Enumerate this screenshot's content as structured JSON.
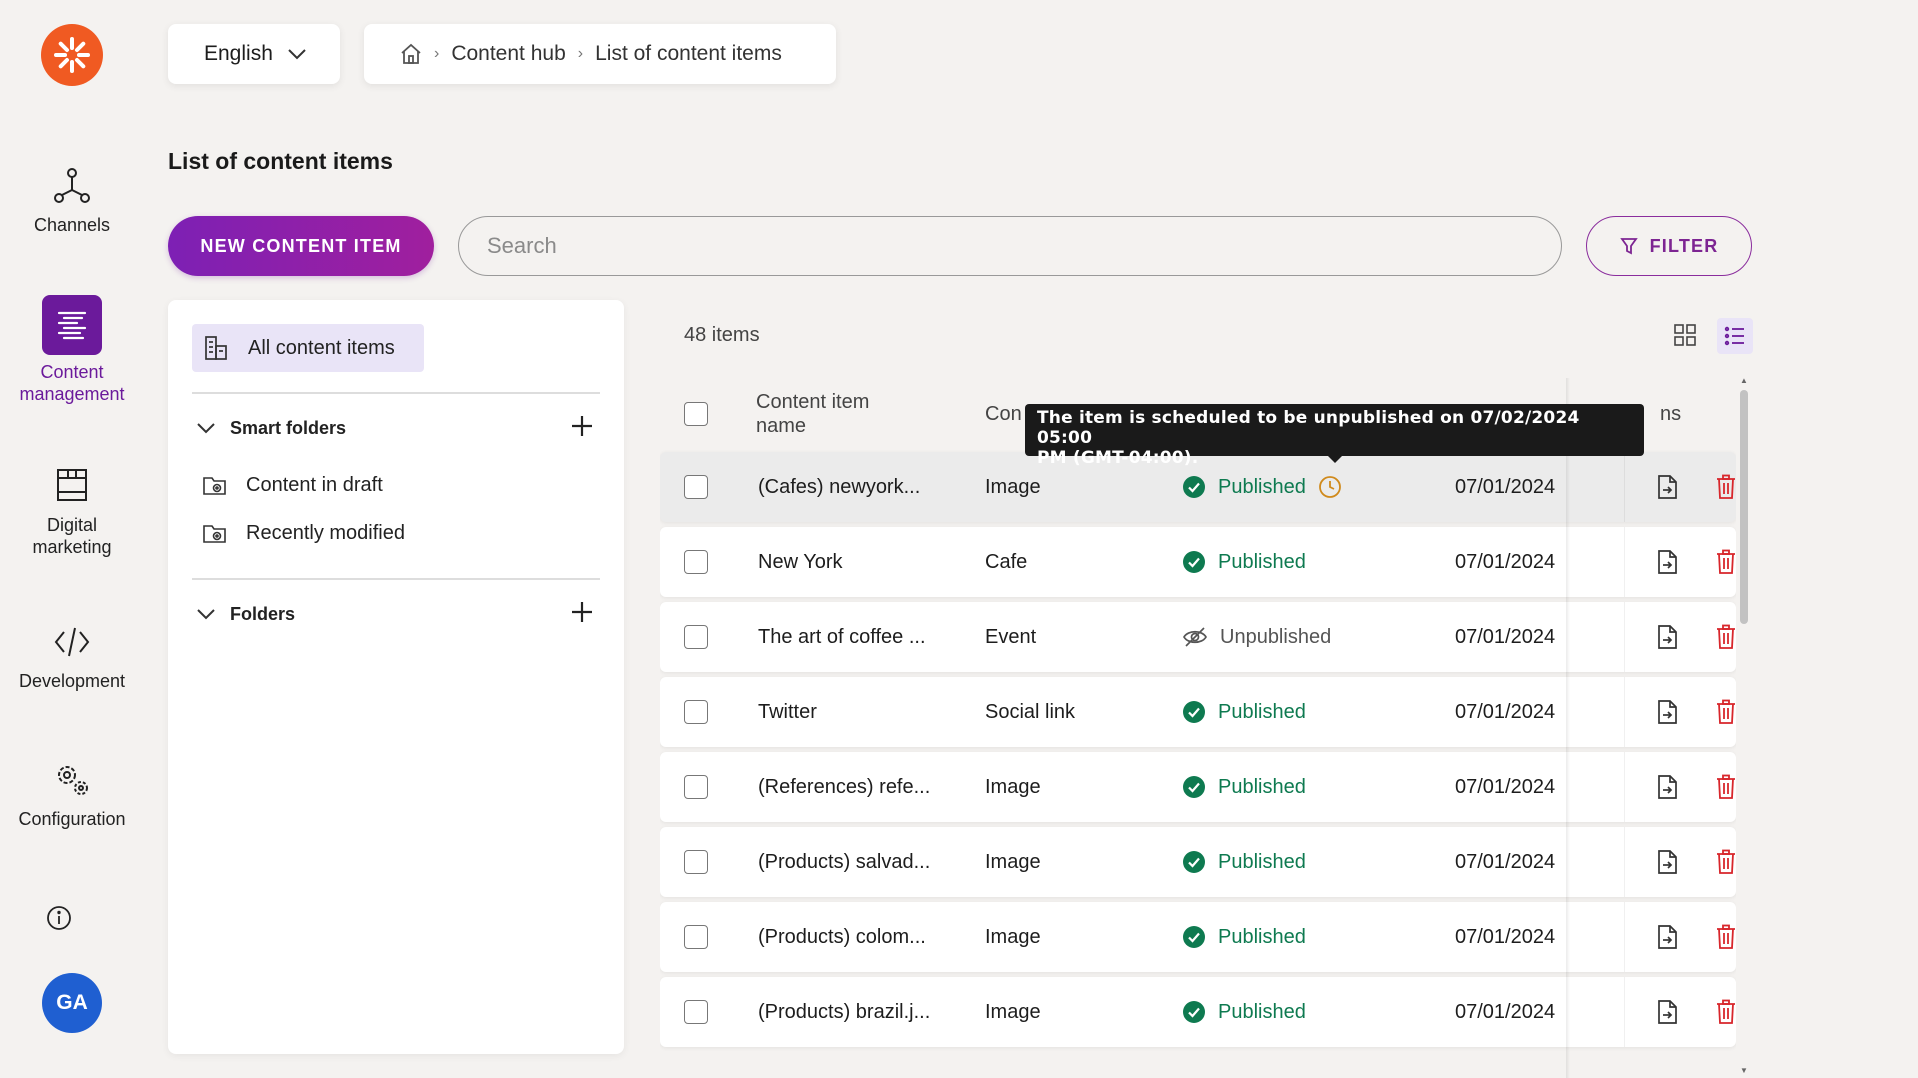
{
  "language": {
    "selected": "English"
  },
  "breadcrumb": {
    "section": "Content hub",
    "current": "List of content items"
  },
  "nav": {
    "items": [
      {
        "label": "Channels"
      },
      {
        "label_line1": "Content",
        "label_line2": "management"
      },
      {
        "label_line1": "Digital",
        "label_line2": "marketing"
      },
      {
        "label": "Development"
      },
      {
        "label": "Configuration"
      }
    ],
    "avatar_initials": "GA"
  },
  "page": {
    "title": "List of content items"
  },
  "toolbar": {
    "new_label": "NEW CONTENT ITEM",
    "search_placeholder": "Search",
    "filter_label": "FILTER"
  },
  "folders": {
    "all_items_label": "All content items",
    "smart_folders_label": "Smart folders",
    "smart_items": [
      {
        "label": "Content in draft"
      },
      {
        "label": "Recently modified"
      }
    ],
    "folders_label": "Folders"
  },
  "list": {
    "count_label": "48 items",
    "headers": {
      "name_line1": "Content item",
      "name_line2": "name",
      "type": "Con",
      "actions": "ns"
    },
    "rows": [
      {
        "name": "(Cafes) newyork...",
        "type": "Image",
        "status": "Published",
        "date": "07/01/2024",
        "scheduled": true
      },
      {
        "name": "New York",
        "type": "Cafe",
        "status": "Published",
        "date": "07/01/2024"
      },
      {
        "name": "The art of coffee ...",
        "type": "Event",
        "status": "Unpublished",
        "date": "07/01/2024"
      },
      {
        "name": "Twitter",
        "type": "Social link",
        "status": "Published",
        "date": "07/01/2024"
      },
      {
        "name": "(References) refe...",
        "type": "Image",
        "status": "Published",
        "date": "07/01/2024"
      },
      {
        "name": "(Products) salvad...",
        "type": "Image",
        "status": "Published",
        "date": "07/01/2024"
      },
      {
        "name": "(Products) colom...",
        "type": "Image",
        "status": "Published",
        "date": "07/01/2024"
      },
      {
        "name": "(Products) brazil.j...",
        "type": "Image",
        "status": "Published",
        "date": "07/01/2024"
      }
    ]
  },
  "tooltip": {
    "line1": "The item is scheduled to be unpublished on 07/02/2024 05:00",
    "line2": "PM (GMT-04:00)."
  },
  "colors": {
    "accent": "#6b1a9b",
    "published": "#0e7a50",
    "delete": "#d8262b",
    "logo": "#f05a22",
    "avatar": "#1f5fd1"
  }
}
